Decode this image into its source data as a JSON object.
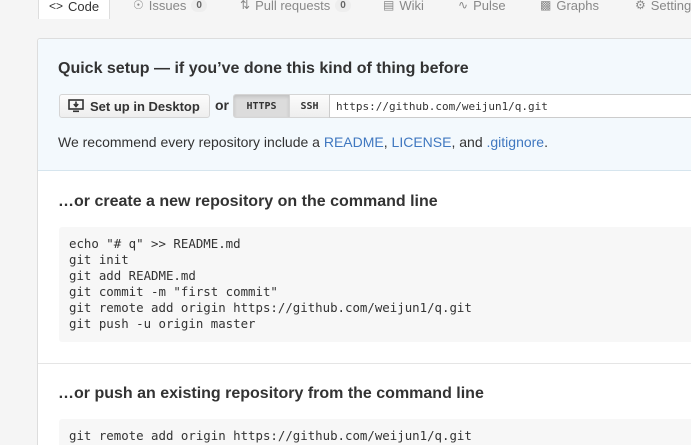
{
  "tabs": [
    {
      "label": "Code",
      "icon": "code-icon",
      "active": true
    },
    {
      "label": "Issues",
      "icon": "issue-icon",
      "count": "0"
    },
    {
      "label": "Pull requests",
      "icon": "pull-request-icon",
      "count": "0"
    },
    {
      "label": "Wiki",
      "icon": "book-icon"
    },
    {
      "label": "Pulse",
      "icon": "pulse-icon"
    },
    {
      "label": "Graphs",
      "icon": "graph-icon"
    },
    {
      "label": "Settings",
      "icon": "gear-icon"
    }
  ],
  "setup": {
    "title": "Quick setup — if you’ve done this kind of thing before",
    "desktop_button": "Set up in Desktop",
    "or": "or",
    "https_label": "HTTPS",
    "ssh_label": "SSH",
    "clone_url": "https://github.com/weijun1/q.git",
    "recommend_prefix": "We recommend every repository include a ",
    "readme_link": "README",
    "sep1": ", ",
    "license_link": "LICENSE",
    "sep2": ", and ",
    "gitignore_link": ".gitignore",
    "period": "."
  },
  "create_section": {
    "title": "…or create a new repository on the command line",
    "code": "echo \"# q\" >> README.md\ngit init\ngit add README.md\ngit commit -m \"first commit\"\ngit remote add origin https://github.com/weijun1/q.git\ngit push -u origin master"
  },
  "push_section": {
    "title": "…or push an existing repository from the command line",
    "code": "git remote add origin https://github.com/weijun1/q.git"
  }
}
